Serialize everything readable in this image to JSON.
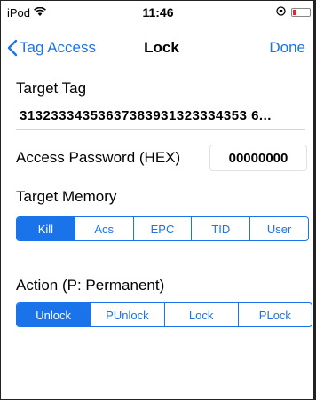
{
  "status": {
    "carrier": "iPod",
    "time": "11:46"
  },
  "nav": {
    "back_label": "Tag Access",
    "title": "Lock",
    "done_label": "Done"
  },
  "target_tag": {
    "label": "Target Tag",
    "value": "31323334353637383931323334353 6..."
  },
  "password": {
    "label": "Access Password (HEX)",
    "value": "00000000"
  },
  "memory": {
    "label": "Target Memory",
    "options": [
      "Kill",
      "Acs",
      "EPC",
      "TID",
      "User"
    ],
    "selected": "Kill"
  },
  "action": {
    "label": "Action (P: Permanent)",
    "options": [
      "Unlock",
      "PUnlock",
      "Lock",
      "PLock"
    ],
    "selected": "Unlock"
  },
  "colors": {
    "accent": "#1a73e8",
    "battery": "#e8242b"
  }
}
